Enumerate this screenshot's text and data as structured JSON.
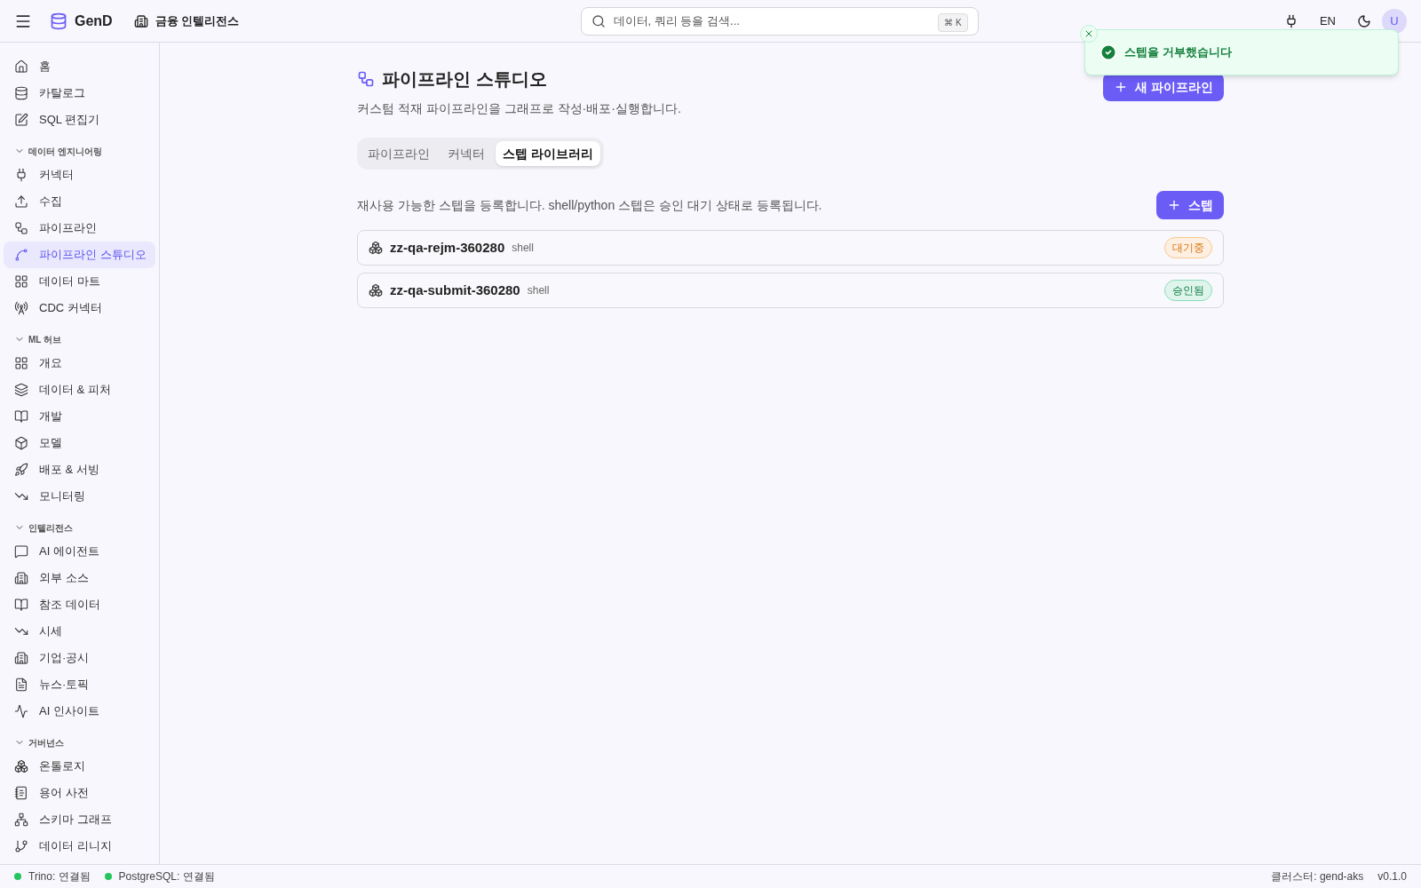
{
  "header": {
    "logo": "GenD",
    "workspace": "금융 인텔리전스",
    "search": {
      "placeholder": "데이터, 쿼리 등을 검색...",
      "shortcut": "⌘ K"
    },
    "language": "EN",
    "avatar": "U"
  },
  "sidebar": {
    "items": [
      {
        "label": "홈",
        "selected": false
      },
      {
        "label": "카탈로그",
        "selected": false
      },
      {
        "label": "SQL 편집기",
        "selected": false
      }
    ],
    "sections": [
      {
        "title": "데이터 엔지니어링",
        "expanded": true,
        "items": [
          {
            "label": "커넥터",
            "selected": false
          },
          {
            "label": "수집",
            "selected": false
          },
          {
            "label": "파이프라인",
            "selected": false
          },
          {
            "label": "파이프라인 스튜디오",
            "selected": true
          },
          {
            "label": "데이터 마트",
            "selected": false
          },
          {
            "label": "CDC 커넥터",
            "selected": false
          }
        ]
      },
      {
        "title": "ML 허브",
        "expanded": true,
        "items": [
          {
            "label": "개요",
            "selected": false
          },
          {
            "label": "데이터 & 피처",
            "selected": false
          },
          {
            "label": "개발",
            "selected": false
          },
          {
            "label": "모델",
            "selected": false
          },
          {
            "label": "배포 & 서빙",
            "selected": false
          },
          {
            "label": "모니터링",
            "selected": false
          }
        ]
      },
      {
        "title": "인텔리전스",
        "expanded": true,
        "items": [
          {
            "label": "AI 에이전트",
            "selected": false
          },
          {
            "label": "외부 소스",
            "selected": false
          },
          {
            "label": "참조 데이터",
            "selected": false
          },
          {
            "label": "시세",
            "selected": false
          },
          {
            "label": "기업·공시",
            "selected": false
          },
          {
            "label": "뉴스·토픽",
            "selected": false
          },
          {
            "label": "AI 인사이트",
            "selected": false
          }
        ]
      },
      {
        "title": "거버넌스",
        "expanded": true,
        "items": [
          {
            "label": "온톨로지",
            "selected": false
          },
          {
            "label": "용어 사전",
            "selected": false
          },
          {
            "label": "스키마 그래프",
            "selected": false
          },
          {
            "label": "데이터 리니지",
            "selected": false
          }
        ]
      }
    ]
  },
  "page": {
    "title": "파이프라인 스튜디오",
    "subtitle": "커스텀 적재 파이프라인을 그래프로 작성·배포·실행합니다.",
    "new_button": "새 파이프라인",
    "tabs": [
      {
        "label": "파이프라인",
        "selected": false
      },
      {
        "label": "커넥터",
        "selected": false
      },
      {
        "label": "스텝 라이브러리",
        "selected": true
      }
    ],
    "description": "재사용 가능한 스텝을 등록합니다. shell/python 스텝은 승인 대기 상태로 등록됩니다.",
    "add_button": "스텝",
    "steps": [
      {
        "name": "zz-qa-rejm-360280",
        "type": "shell",
        "status": "대기중",
        "kind": "pending"
      },
      {
        "name": "zz-qa-submit-360280",
        "type": "shell",
        "status": "승인됨",
        "kind": "approved"
      }
    ]
  },
  "toast": {
    "message": "스텝을 거부했습니다",
    "kind": "success"
  },
  "status_bar": {
    "connections": [
      {
        "label": "Trino: 연결됨",
        "connected": true
      },
      {
        "label": "PostgreSQL: 연결됨",
        "connected": true
      }
    ],
    "cluster": "클러스터: gend-aks",
    "version": "v0.1.0"
  }
}
